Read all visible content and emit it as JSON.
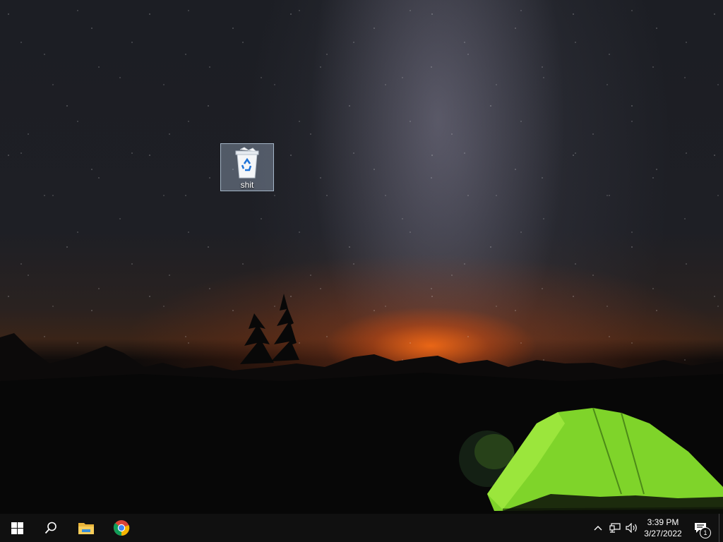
{
  "desktop": {
    "icons": [
      {
        "label": "shit",
        "icon": "recycle-bin-icon"
      }
    ]
  },
  "taskbar": {
    "start": {
      "icon": "windows-start-icon"
    },
    "search": {
      "icon": "search-icon"
    },
    "pinned": [
      {
        "icon": "file-explorer-icon"
      },
      {
        "icon": "chrome-icon"
      }
    ],
    "tray": {
      "icons": [
        "chevron-up-icon",
        "network-icon",
        "volume-icon"
      ],
      "time": "3:39 PM",
      "date": "3/27/2022",
      "notification_count": "1"
    }
  },
  "colors": {
    "taskbar": "#101010",
    "tent": "#7fd42a",
    "glow": "#ff6a14"
  }
}
